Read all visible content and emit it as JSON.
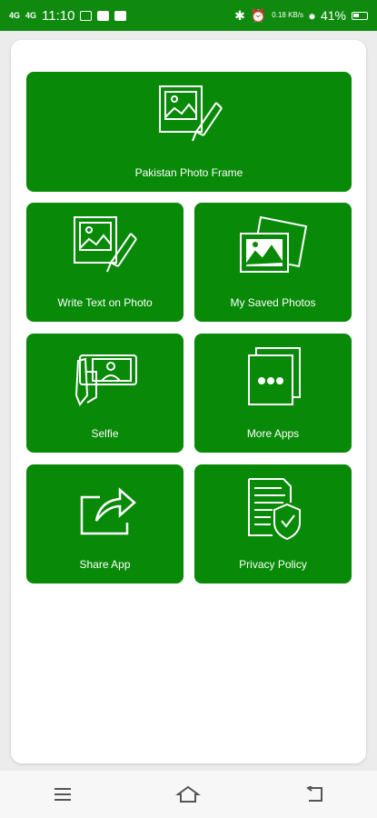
{
  "status_bar": {
    "signal_left": "4G",
    "signal_right": "4G",
    "time": "11:10",
    "speed": "0.18 KB/s",
    "battery": "41%"
  },
  "tiles": [
    {
      "label": "Pakistan Photo Frame",
      "icon": "photo-edit-icon"
    },
    {
      "label": "Write Text on Photo",
      "icon": "photo-edit-icon"
    },
    {
      "label": "My Saved Photos",
      "icon": "photos-stack-icon"
    },
    {
      "label": "Selfie",
      "icon": "selfie-phone-icon"
    },
    {
      "label": "More Apps",
      "icon": "more-apps-icon"
    },
    {
      "label": "Share App",
      "icon": "share-icon"
    },
    {
      "label": "Privacy Policy",
      "icon": "privacy-shield-icon"
    }
  ],
  "colors": {
    "status_bar": "#0f8a0f",
    "tile": "#088a08",
    "card": "#ffffff",
    "background": "#ececec"
  },
  "nav": {
    "menu_icon": "menu-icon",
    "home_icon": "home-icon",
    "back_icon": "back-icon"
  }
}
